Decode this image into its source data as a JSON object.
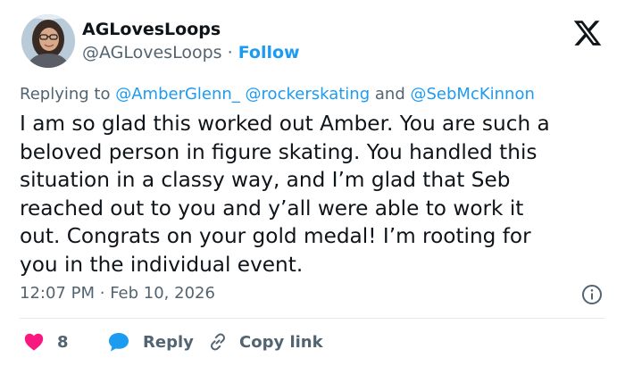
{
  "author": {
    "display_name": "AGLovesLoops",
    "handle": "@AGLovesLoops",
    "separator": "·",
    "follow_label": "Follow"
  },
  "reply_to": {
    "prefix": "Replying to",
    "mention_1": "@AmberGlenn_",
    "mention_2": "@rockerskating",
    "conjunction": "and",
    "mention_3": "@SebMcKinnon"
  },
  "tweet": {
    "text": "I am so glad this worked out Amber. You are such a\nbeloved person in figure skating. You handled this\nsituation in a classy way, and I’m glad that Seb\nreached out to you and y’all were able to work it\nout. Congrats on your gold medal! I’m rooting for\nyou in the individual event.",
    "time": "12:07 PM",
    "separator": "·",
    "date": "Feb 10, 2026"
  },
  "actions": {
    "like_count": "8",
    "reply_label": "Reply",
    "copy_label": "Copy link"
  },
  "colors": {
    "accent": "#1d9bf0",
    "like": "#f91880",
    "secondary_text": "#536471",
    "primary_text": "#0f1419"
  },
  "icons": {
    "logo": "x-logo-icon",
    "like": "heart-icon",
    "reply": "speech-bubble-icon",
    "copy": "link-icon",
    "info": "info-icon"
  }
}
